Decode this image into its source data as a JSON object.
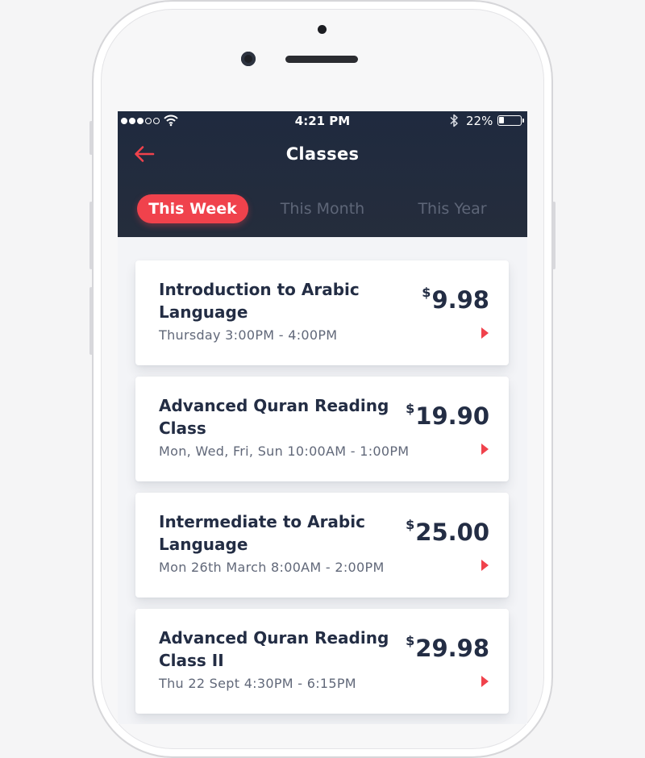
{
  "status_bar": {
    "time": "4:21 PM",
    "battery_percent": "22%",
    "battery_level": 0.22,
    "signal_bars_filled": 3,
    "signal_bars_total": 5
  },
  "header": {
    "title": "Classes",
    "back_icon": "arrow-left-icon",
    "accent_color": "#f0424c"
  },
  "tabs": [
    {
      "label": "This Week",
      "active": true
    },
    {
      "label": "This Month",
      "active": false
    },
    {
      "label": "This Year",
      "active": false
    }
  ],
  "classes": [
    {
      "title": "Introduction to Arabic Language",
      "schedule": "Thursday 3:00PM - 4:00PM",
      "currency": "$",
      "price": "9.98"
    },
    {
      "title": "Advanced Quran Reading Class",
      "schedule": "Mon, Wed, Fri, Sun 10:00AM - 1:00PM",
      "currency": "$",
      "price": "19.90"
    },
    {
      "title": "Intermediate to Arabic Language",
      "schedule": "Mon 26th March 8:00AM - 2:00PM",
      "currency": "$",
      "price": "25.00"
    },
    {
      "title": "Advanced Quran Reading Class II",
      "schedule": "Thu 22 Sept 4:30PM - 6:15PM",
      "currency": "$",
      "price": "29.98"
    }
  ]
}
